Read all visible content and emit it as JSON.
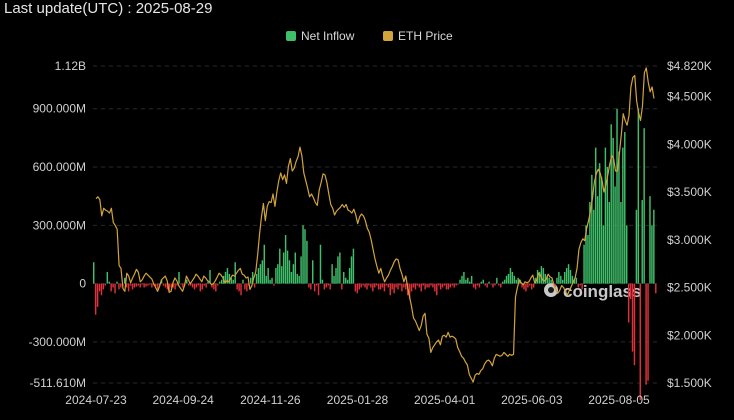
{
  "header": {
    "title": "Last update(UTC) : 2025-08-29"
  },
  "chart_data": {
    "type": "bar",
    "legend": [
      {
        "name": "Net Inflow",
        "color": "#3fbf6a"
      },
      {
        "name": "ETH Price",
        "color": "#d2a43a"
      }
    ],
    "legend_position": "top-center",
    "watermark": "coinglass",
    "colors": {
      "positive": "#3fbf6a",
      "negative": "#e0303a",
      "price": "#d2a43a",
      "grid": "#2a2a2a"
    },
    "x_ticks": [
      "2024-07-23",
      "2024-09-24",
      "2024-11-26",
      "2025-01-28",
      "2025-04-01",
      "2025-06-03",
      "2025-08-05"
    ],
    "x_range_days": [
      0,
      402
    ],
    "left_axis": {
      "ticks": [
        {
          "v": 1120000000,
          "label": "1.12B"
        },
        {
          "v": 900000000,
          "label": "900.000M"
        },
        {
          "v": 600000000,
          "label": "600.000M"
        },
        {
          "v": 300000000,
          "label": "300.000M"
        },
        {
          "v": 0,
          "label": "0"
        },
        {
          "v": -300000000,
          "label": "-300.000M"
        },
        {
          "v": -511610000,
          "label": "-511.610M"
        }
      ],
      "min": -511610000,
      "max": 1120000000
    },
    "right_axis": {
      "ticks": [
        {
          "v": 4820,
          "label": "$4.820K"
        },
        {
          "v": 4500,
          "label": "$4.500K"
        },
        {
          "v": 4000,
          "label": "$4.000K"
        },
        {
          "v": 3500,
          "label": "$3.500K"
        },
        {
          "v": 3000,
          "label": "$3.000K"
        },
        {
          "v": 2500,
          "label": "$2.500K"
        },
        {
          "v": 2000,
          "label": "$2.000K"
        },
        {
          "v": 1500,
          "label": "$1.500K"
        }
      ],
      "min": 1500,
      "max": 4820
    },
    "inflow_series": {
      "name": "Net Inflow",
      "values_musd": [
        110,
        -160,
        -120,
        -40,
        -60,
        -30,
        -10,
        60,
        10,
        -40,
        -20,
        -50,
        10,
        -30,
        -20,
        -10,
        30,
        -20,
        -40,
        -10,
        -30,
        -20,
        -15,
        -10,
        -20,
        -5,
        -20,
        -15,
        -10,
        -5,
        -20,
        -10,
        -15,
        -30,
        -10,
        20,
        -10,
        -20,
        -30,
        -40,
        -20,
        -20,
        -30,
        -10,
        60,
        -5,
        -20,
        -10,
        20,
        -10,
        -10,
        -20,
        -30,
        -20,
        -10,
        -40,
        -30,
        -10,
        -20,
        10,
        70,
        -20,
        -30,
        -40,
        -10,
        10,
        20,
        40,
        60,
        80,
        50,
        30,
        20,
        110,
        -30,
        -40,
        -60,
        20,
        -30,
        -40,
        -10,
        30,
        60,
        -20,
        50,
        80,
        100,
        120,
        200,
        40,
        80,
        20,
        30,
        -10,
        80,
        100,
        180,
        90,
        160,
        250,
        170,
        120,
        60,
        100,
        160,
        50,
        40,
        140,
        300,
        280,
        220,
        -20,
        -30,
        120,
        -40,
        -10,
        -60,
        200,
        20,
        -30,
        -20,
        -10,
        -30,
        100,
        40,
        80,
        140,
        160,
        -30,
        60,
        30,
        20,
        80,
        140,
        180,
        -40,
        -50,
        -30,
        -20,
        -10,
        -20,
        -30,
        -10,
        -20,
        -40,
        -20,
        -10,
        -30,
        -30,
        -20,
        -40,
        -10,
        -20,
        -60,
        -30,
        -50,
        -20,
        -30,
        -10,
        -40,
        -20,
        -30,
        -60,
        -80,
        -40,
        -20,
        -30,
        -10,
        -20,
        -40,
        -10,
        -30,
        -20,
        -20,
        -10,
        -20,
        -40,
        -60,
        -10,
        -30,
        -20,
        -10,
        -30,
        -30,
        -20,
        -10,
        -20,
        -10,
        -5,
        20,
        40,
        60,
        20,
        30,
        10,
        40,
        -20,
        -30,
        -10,
        -20,
        10,
        20,
        -10,
        -20,
        10,
        -5,
        -20,
        -10,
        30,
        -10,
        -20,
        10,
        20,
        40,
        50,
        80,
        60,
        40,
        20,
        30,
        20,
        -20,
        -30,
        -40,
        -20,
        -10,
        -30,
        -20,
        30,
        70,
        60,
        90,
        80,
        50,
        40,
        30,
        20,
        10,
        -20,
        30,
        60,
        40,
        20,
        60,
        80,
        100,
        70,
        40,
        20,
        30,
        -20,
        -10,
        -30,
        200,
        300,
        250,
        420,
        560,
        380,
        700,
        450,
        620,
        550,
        300,
        700,
        600,
        420,
        820,
        750,
        500,
        900,
        680,
        420,
        700,
        780,
        300,
        -200,
        -80,
        -350,
        -420,
        380,
        900,
        -600,
        430,
        800,
        -520,
        -500,
        450,
        300,
        380,
        -50
      ]
    },
    "price_series": {
      "name": "ETH Price",
      "values_usd": [
        3430,
        3450,
        3420,
        3250,
        3330,
        3310,
        3300,
        3280,
        3330,
        3180,
        3150,
        3110,
        2730,
        2700,
        2490,
        2460,
        2650,
        2620,
        2550,
        2600,
        2640,
        2690,
        2660,
        2560,
        2580,
        2620,
        2650,
        2630,
        2610,
        2590,
        2540,
        2500,
        2460,
        2510,
        2580,
        2600,
        2620,
        2570,
        2450,
        2460,
        2550,
        2600,
        2570,
        2520,
        2490,
        2460,
        2520,
        2620,
        2580,
        2540,
        2570,
        2600,
        2640,
        2620,
        2590,
        2560,
        2620,
        2600,
        2570,
        2560,
        2530,
        2540,
        2570,
        2610,
        2650,
        2630,
        2600,
        2550,
        2570,
        2560,
        2600,
        2630,
        2620,
        2650,
        2680,
        2700,
        2640,
        2630,
        2600,
        2610,
        2480,
        2520,
        2600,
        2660,
        2840,
        3060,
        3240,
        3380,
        3200,
        3350,
        3400,
        3390,
        3480,
        3350,
        3500,
        3620,
        3700,
        3630,
        3680,
        3590,
        3770,
        3850,
        3720,
        3750,
        3820,
        3870,
        3970,
        3880,
        3700,
        3620,
        3540,
        3450,
        3480,
        3440,
        3390,
        3360,
        3520,
        3600,
        3690,
        3680,
        3600,
        3480,
        3370,
        3330,
        3260,
        3300,
        3320,
        3340,
        3370,
        3340,
        3370,
        3310,
        3300,
        3280,
        3320,
        3260,
        3170,
        3240,
        3270,
        3250,
        3200,
        3120,
        3080,
        3000,
        2900,
        2800,
        2720,
        2650,
        2700,
        2620,
        2560,
        2600,
        2630,
        2680,
        2720,
        2770,
        2800,
        2790,
        2700,
        2640,
        2560,
        2620,
        2500,
        2400,
        2300,
        2180,
        2150,
        2100,
        2050,
        2100,
        2200,
        2230,
        2010,
        1970,
        1820,
        1870,
        1900,
        1930,
        1950,
        1900,
        1990,
        2000,
        1980,
        2030,
        1980,
        1990,
        1980,
        1960,
        1870,
        1830,
        1780,
        1760,
        1720,
        1690,
        1590,
        1550,
        1510,
        1580,
        1600,
        1590,
        1630,
        1650,
        1700,
        1730,
        1740,
        1720,
        1680,
        1760,
        1800,
        1790,
        1780,
        1790,
        1820,
        1800,
        1780,
        1800,
        1790,
        1800,
        2400,
        2500,
        2580,
        2550,
        2530,
        2560,
        2550,
        2560,
        2600,
        2630,
        2550,
        2570,
        2650,
        2630,
        2580,
        2570,
        2590,
        2640,
        2610,
        2600,
        2520,
        2480,
        2440,
        2470,
        2520,
        2500,
        2460,
        2420,
        2470,
        2510,
        2560,
        2600,
        2700,
        2900,
        2970,
        3010,
        2990,
        3120,
        3200,
        3300,
        3430,
        3600,
        3690,
        3740,
        3700,
        3620,
        3500,
        3580,
        3680,
        3790,
        3880,
        3850,
        3720,
        3720,
        3900,
        4100,
        4320,
        4250,
        4200,
        4300,
        4600,
        4700,
        4720,
        4450,
        4330,
        4250,
        4400,
        4750,
        4800,
        4650,
        4550,
        4600,
        4480
      ]
    }
  }
}
